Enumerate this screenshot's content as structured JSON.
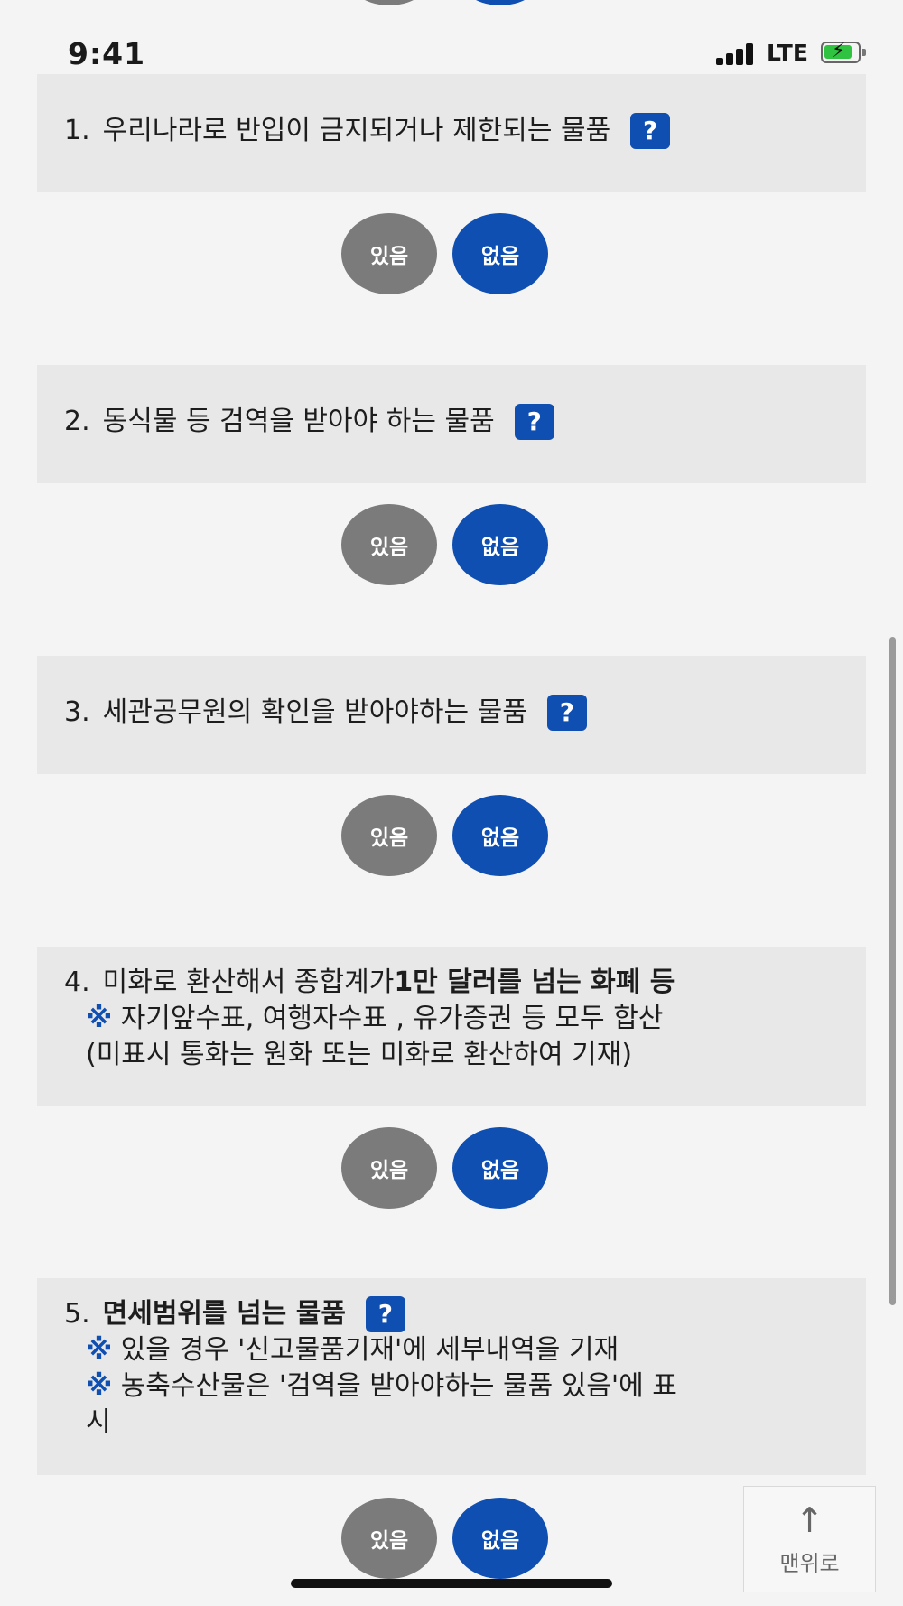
{
  "status_bar": {
    "time": "9:41",
    "network": "LTE"
  },
  "questions": [
    {
      "number": "1.",
      "text": "우리나라로 반입이 금지되거나 제한되는 물품",
      "help": "?",
      "yes": "있음",
      "no": "없음"
    },
    {
      "number": "2.",
      "text": "동식물 등 검역을 받아야 하는 물품",
      "help": "?",
      "yes": "있음",
      "no": "없음"
    },
    {
      "number": "3.",
      "text": "세관공무원의 확인을 받아야하는 물품",
      "help": "?",
      "yes": "있음",
      "no": "없음"
    },
    {
      "number": "4.",
      "text_plain": "미화로 환산해서 종합계가 ",
      "text_bold": "1만 달러를 넘는 화폐 등",
      "note_mark": "※",
      "note_1": " 자기앞수표, 여행자수표 , 유가증권 등 모두 합산",
      "note_2": "(미표시 통화는 원화 또는 미화로 환산하여 기재)",
      "yes": "있음",
      "no": "없음"
    },
    {
      "number": "5.",
      "text_bold": "면세범위를 넘는 물품",
      "help": "?",
      "note_mark": "※",
      "note_1": " 있을 경우 '신고물품기재'에 세부내역을 기재",
      "note_2": " 농축수산물은 '검역을 받아야하는 물품 있음'에 표",
      "note_3": "시",
      "yes": "있음",
      "no": "없음"
    }
  ],
  "back_to_top": {
    "arrow": "↑",
    "label": "맨위로"
  }
}
